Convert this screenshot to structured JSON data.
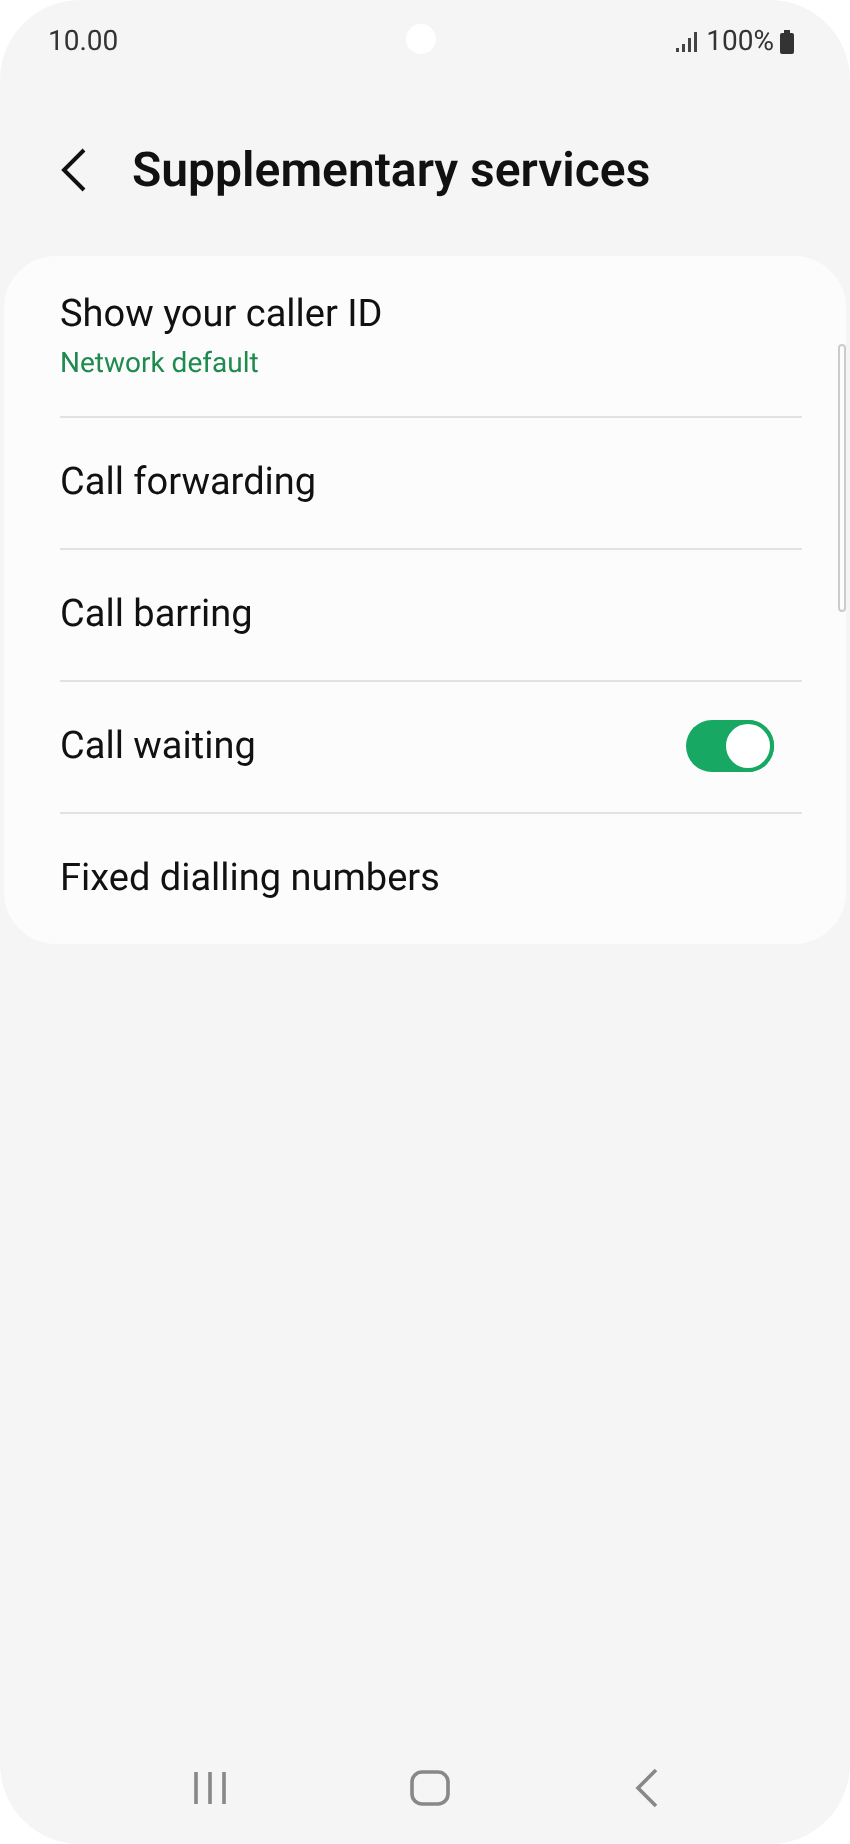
{
  "status_bar": {
    "time": "10.00",
    "battery": "100%"
  },
  "header": {
    "title": "Supplementary services"
  },
  "items": [
    {
      "kind": "subtitle",
      "label": "Show your caller ID",
      "subtitle": "Network default"
    },
    {
      "kind": "plain",
      "label": "Call forwarding"
    },
    {
      "kind": "plain",
      "label": "Call barring"
    },
    {
      "kind": "switch",
      "label": "Call waiting",
      "on": true
    },
    {
      "kind": "plain",
      "label": "Fixed dialling numbers"
    }
  ]
}
